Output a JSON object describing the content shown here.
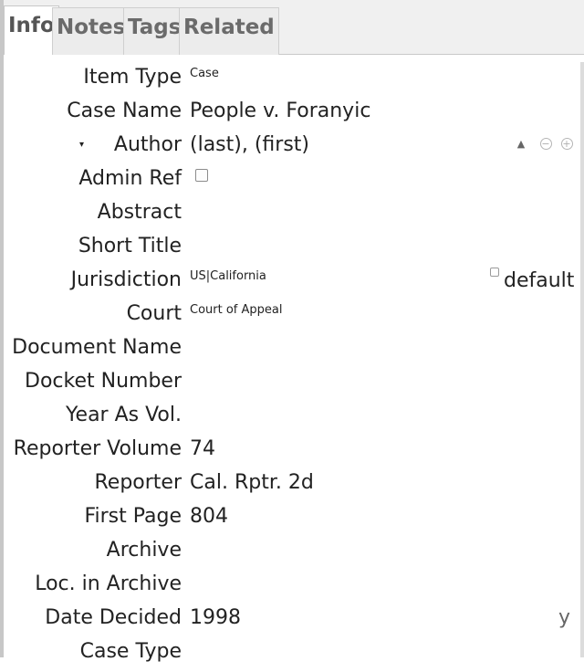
{
  "tabs": [
    {
      "label": "Info"
    },
    {
      "label": "Notes"
    },
    {
      "label": "Tags"
    },
    {
      "label": "Related"
    }
  ],
  "fields": {
    "item_type": {
      "label": "Item Type",
      "value": "Case"
    },
    "case_name": {
      "label": "Case Name",
      "value": "People v. Foranyic"
    },
    "author": {
      "label": "Author",
      "value": "(last), (first)"
    },
    "admin_ref": {
      "label": "Admin Ref",
      "checked": false
    },
    "abstract": {
      "label": "Abstract",
      "value": ""
    },
    "short_title": {
      "label": "Short Title",
      "value": ""
    },
    "jurisdiction": {
      "label": "Jurisdiction",
      "value": "US|California",
      "default_label": "default"
    },
    "court": {
      "label": "Court",
      "value": "Court of Appeal"
    },
    "document_name": {
      "label": "Document Name",
      "value": ""
    },
    "docket_number": {
      "label": "Docket Number",
      "value": ""
    },
    "year_as_vol": {
      "label": "Year As Vol.",
      "value": ""
    },
    "reporter_volume": {
      "label": "Reporter Volume",
      "value": "74"
    },
    "reporter": {
      "label": "Reporter",
      "value": "Cal. Rptr. 2d"
    },
    "first_page": {
      "label": "First Page",
      "value": "804"
    },
    "archive": {
      "label": "Archive",
      "value": ""
    },
    "loc_in_archive": {
      "label": "Loc. in Archive",
      "value": ""
    },
    "date_decided": {
      "label": "Date Decided",
      "value": "1998",
      "mode": "y"
    },
    "case_type": {
      "label": "Case Type",
      "value": ""
    }
  },
  "icons": {
    "author_type": "person-icon",
    "remove_creator": "minus-circle-icon",
    "add_creator": "plus-circle-icon",
    "twisty": "disclosure-triangle-icon"
  },
  "glyphs": {
    "twisty": "▾",
    "person": "▲",
    "minus": "−",
    "plus": "+"
  }
}
